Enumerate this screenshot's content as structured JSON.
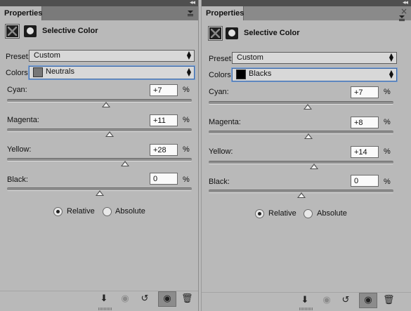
{
  "panels": [
    {
      "tab_label": "Properties",
      "collapse_glyph": "◂◂",
      "title": "Selective Color",
      "preset": {
        "label": "Preset:",
        "value": "Custom"
      },
      "colors": {
        "label": "Colors:",
        "value": "Neutrals",
        "swatch_color": "#777777"
      },
      "sliders": [
        {
          "label": "Cyan:",
          "value": "+7",
          "unit": "%",
          "percent": 7
        },
        {
          "label": "Magenta:",
          "value": "+11",
          "unit": "%",
          "percent": 11
        },
        {
          "label": "Yellow:",
          "value": "+28",
          "unit": "%",
          "percent": 28
        },
        {
          "label": "Black:",
          "value": "0",
          "unit": "%",
          "percent": 0
        }
      ],
      "method": {
        "relative_label": "Relative",
        "absolute_label": "Absolute",
        "selected": "Relative"
      },
      "bottom_icons": [
        "clip-to-layer-icon",
        "view-previous-icon",
        "reset-icon",
        "eye-icon",
        "trash-icon"
      ]
    },
    {
      "tab_label": "Properties",
      "collapse_glyph": "◂◂",
      "close_glyph": "×",
      "title": "Selective Color",
      "preset": {
        "label": "Preset:",
        "value": "Custom"
      },
      "colors": {
        "label": "Colors:",
        "value": "Blacks",
        "swatch_color": "#000000"
      },
      "sliders": [
        {
          "label": "Cyan:",
          "value": "+7",
          "unit": "%",
          "percent": 7
        },
        {
          "label": "Magenta:",
          "value": "+8",
          "unit": "%",
          "percent": 8
        },
        {
          "label": "Yellow:",
          "value": "+14",
          "unit": "%",
          "percent": 14
        },
        {
          "label": "Black:",
          "value": "0",
          "unit": "%",
          "percent": 0
        }
      ],
      "method": {
        "relative_label": "Relative",
        "absolute_label": "Absolute",
        "selected": "Relative"
      },
      "bottom_icons": [
        "clip-to-layer-icon",
        "view-previous-icon",
        "reset-icon",
        "eye-icon",
        "trash-icon"
      ]
    }
  ],
  "colors": {
    "panel_bg": "#b9b9b9",
    "tabbar_bg": "#7a7a7a",
    "focus_border": "#3d6aa8"
  }
}
